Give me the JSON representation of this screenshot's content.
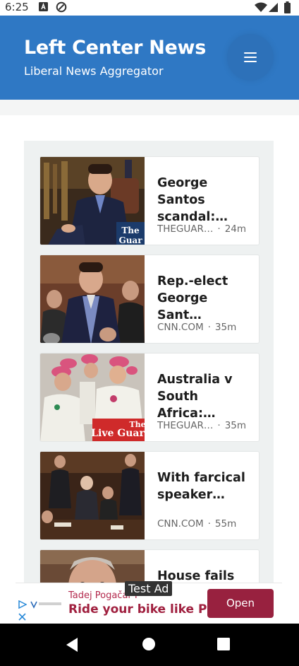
{
  "status_bar": {
    "time": "6:25"
  },
  "header": {
    "title": "Left Center News",
    "subtitle": "Liberal News Aggregator"
  },
  "articles": [
    {
      "title": "George Santos scandal:…",
      "source": "THEGUAR…",
      "age": "24m"
    },
    {
      "title": "Rep.-elect George Sant…",
      "source": "CNN.COM",
      "age": "35m"
    },
    {
      "title": "Australia v South Africa:…",
      "source": "THEGUAR…",
      "age": "35m"
    },
    {
      "title": "With farcical speaker…",
      "source": "CNN.COM",
      "age": "55m"
    },
    {
      "title": "House fails to",
      "source": "",
      "age": ""
    }
  ],
  "ad": {
    "label": "Test Ad",
    "advertiser": "Tadej Pogačar F",
    "headline": "Ride your bike like Pogi",
    "cta": "Open"
  },
  "colors": {
    "header_bg": "#2f78c4",
    "ad_accent": "#98213f"
  }
}
